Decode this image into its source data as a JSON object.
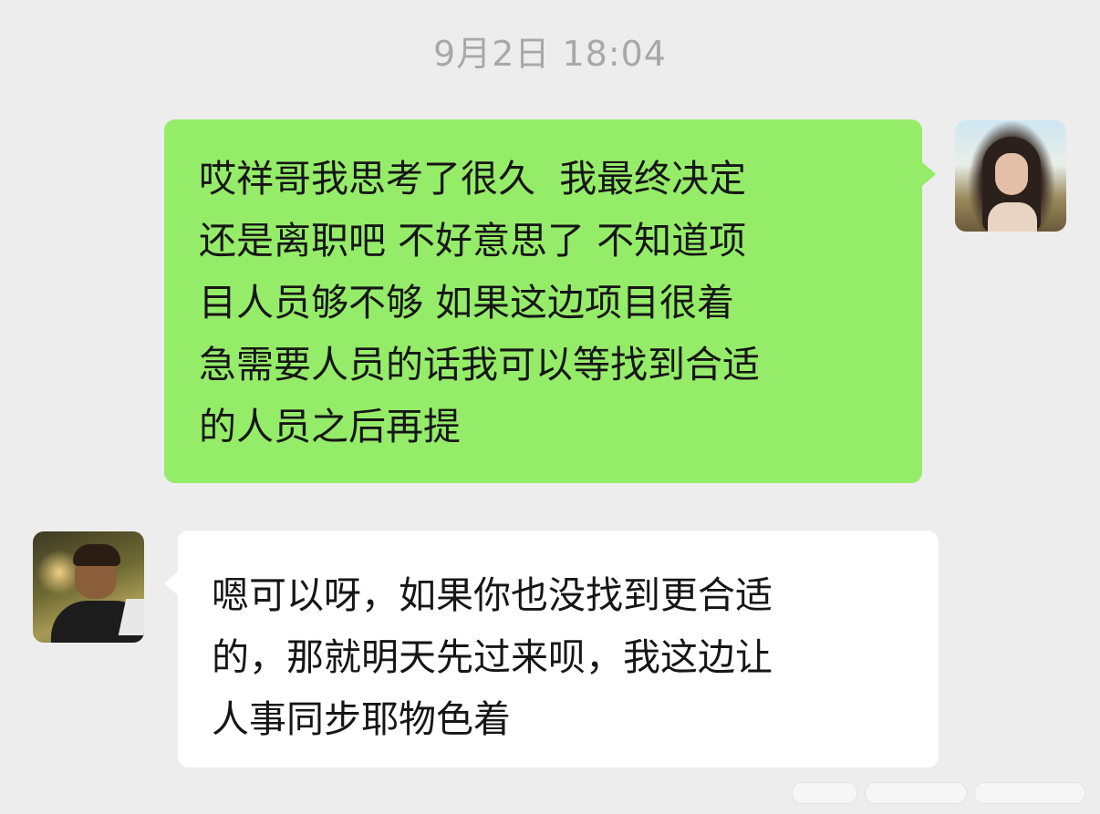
{
  "timestamp": "9月2日 18:04",
  "messages": [
    {
      "sender": "self",
      "avatar_icon": "user-avatar-woman",
      "lines": [
        "哎祥哥我思考了很久  我最终决定",
        "还是离职吧 不好意思了 不知道项",
        "目人员够不够 如果这边项目很着",
        "急需要人员的话我可以等找到合适",
        "的人员之后再提"
      ]
    },
    {
      "sender": "other",
      "avatar_icon": "user-avatar-man",
      "lines": [
        "嗯可以呀，如果你也没找到更合适",
        "的，那就明天先过来呗，我这边让",
        "人事同步耶物色着"
      ]
    }
  ],
  "colors": {
    "background": "#ededed",
    "sent_bubble": "#95ec69",
    "received_bubble": "#ffffff",
    "timestamp_text": "#a8a8a8",
    "message_text": "#161616"
  }
}
